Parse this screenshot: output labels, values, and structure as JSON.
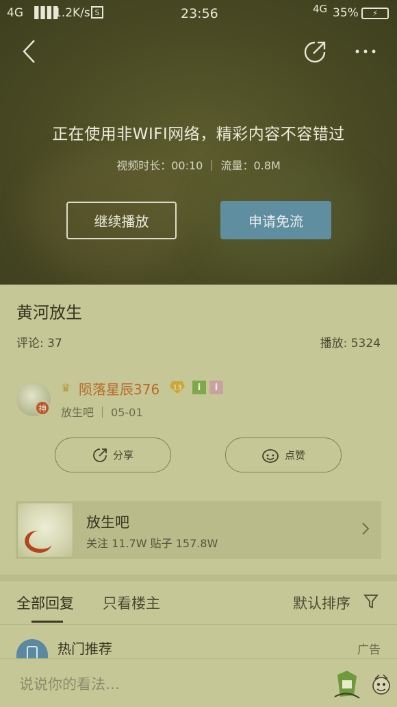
{
  "status_bar": {
    "network": "4G",
    "signal": "▐▐▐▐",
    "speed": "1.2K/s",
    "time": "23:56",
    "network2": "4G",
    "battery": "35%"
  },
  "video": {
    "notice_title": "正在使用非WIFI网络，精彩内容不容错过",
    "notice_sub": "视频时长：00:10  ｜  流量：0.8M",
    "continue_label": "继续播放",
    "free_label": "申请免流"
  },
  "post": {
    "title": "黄河放生",
    "comments": "评论: 37",
    "plays": "播放: 5324"
  },
  "author": {
    "badge": "神",
    "name": "陨落星辰376",
    "level": "13",
    "forum": "放生吧",
    "date": "05-01"
  },
  "actions": {
    "share_label": "分享",
    "like_label": "点赞"
  },
  "forum_card": {
    "name": "放生吧",
    "stats": "关注 11.7W    贴子 157.8W"
  },
  "tabs": {
    "all": "全部回复",
    "op_only": "只看楼主",
    "sort": "默认排序"
  },
  "recommend": {
    "title": "热门推荐",
    "ad": "广告"
  },
  "comment_bar": {
    "placeholder": "说说你的看法…"
  },
  "colors": {
    "accent": "#5f8ea0",
    "username": "#b86c2a",
    "background": "#c6c796"
  }
}
